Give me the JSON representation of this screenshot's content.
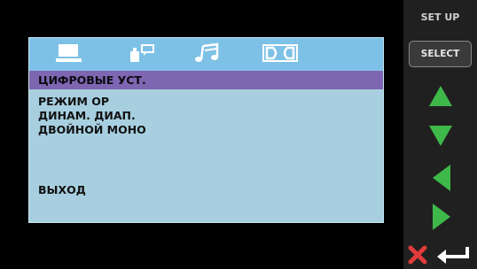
{
  "osd": {
    "tabs": [
      {
        "name": "video-tab",
        "icon": "monitor-icon"
      },
      {
        "name": "speaker-tab",
        "icon": "speaker-settings-icon"
      },
      {
        "name": "audio-tab",
        "icon": "music-note-icon"
      },
      {
        "name": "dolby-tab",
        "icon": "dolby-icon"
      }
    ],
    "header": "ЦИФРОВЫЕ УСТ.",
    "items": [
      "РЕЖИМ ОР",
      "ДИНАМ. ДИАП.",
      "ДВОЙНОЙ МОНО",
      "ВЫХОД"
    ]
  },
  "panel": {
    "setup_label": "SET UP",
    "select_label": "SELECT",
    "arrows": [
      "up-arrow-icon",
      "down-arrow-icon",
      "left-arrow-icon",
      "right-arrow-icon"
    ],
    "bottom_icons": [
      "close-icon",
      "return-icon"
    ]
  },
  "colors": {
    "tab_bar": "#7ec1e6",
    "header_bar": "#7f66b2",
    "osd_background": "#a7cfe0",
    "arrow_green": "#3fb84a",
    "close_red": "#e23b3b"
  }
}
